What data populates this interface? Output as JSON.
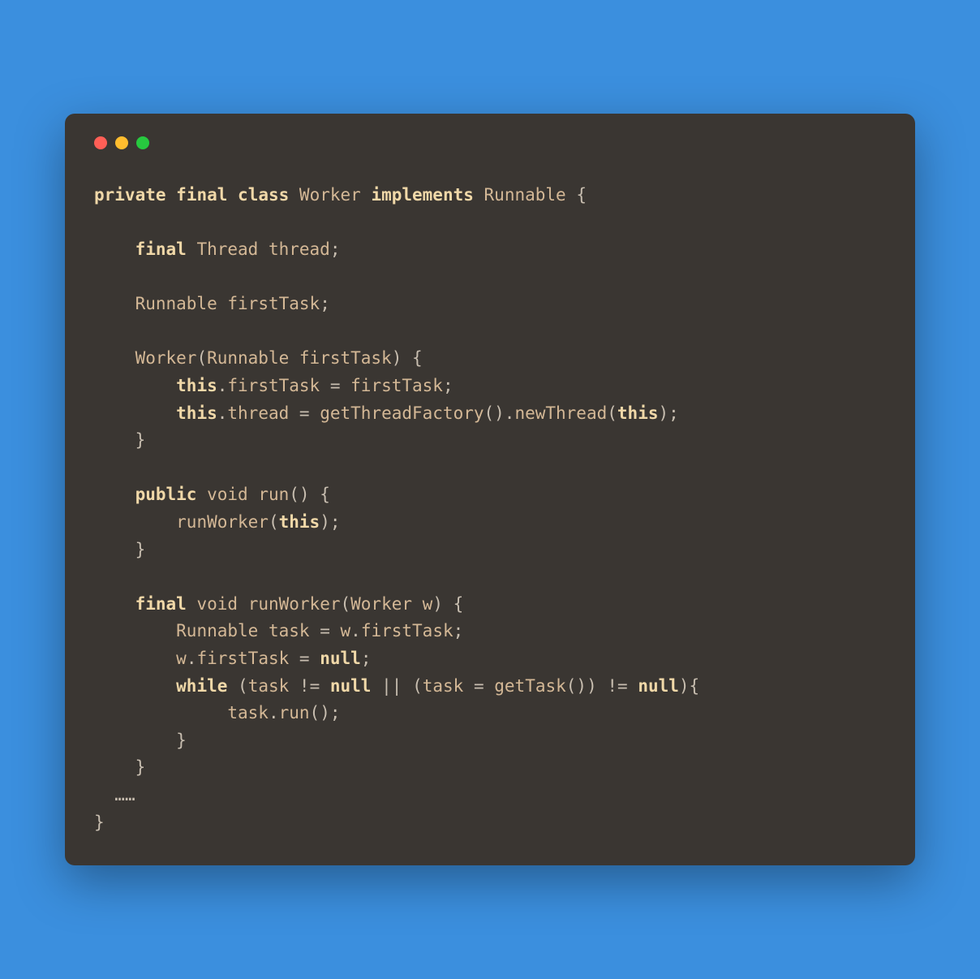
{
  "window": {
    "buttons": [
      "close",
      "minimize",
      "maximize"
    ]
  },
  "code": {
    "tokens": [
      {
        "t": "kw",
        "v": "private"
      },
      {
        "t": "sp",
        "v": " "
      },
      {
        "t": "kw",
        "v": "final"
      },
      {
        "t": "sp",
        "v": " "
      },
      {
        "t": "kw",
        "v": "class"
      },
      {
        "t": "sp",
        "v": " "
      },
      {
        "t": "type",
        "v": "Worker"
      },
      {
        "t": "sp",
        "v": " "
      },
      {
        "t": "kw",
        "v": "implements"
      },
      {
        "t": "sp",
        "v": " "
      },
      {
        "t": "type",
        "v": "Runnable"
      },
      {
        "t": "sp",
        "v": " "
      },
      {
        "t": "punct",
        "v": "{"
      },
      {
        "t": "nl",
        "v": "\n\n"
      },
      {
        "t": "sp",
        "v": "    "
      },
      {
        "t": "kw",
        "v": "final"
      },
      {
        "t": "sp",
        "v": " "
      },
      {
        "t": "type",
        "v": "Thread"
      },
      {
        "t": "sp",
        "v": " "
      },
      {
        "t": "ident",
        "v": "thread"
      },
      {
        "t": "punct",
        "v": ";"
      },
      {
        "t": "nl",
        "v": "\n\n"
      },
      {
        "t": "sp",
        "v": "    "
      },
      {
        "t": "type",
        "v": "Runnable"
      },
      {
        "t": "sp",
        "v": " "
      },
      {
        "t": "ident",
        "v": "firstTask"
      },
      {
        "t": "punct",
        "v": ";"
      },
      {
        "t": "nl",
        "v": "\n\n"
      },
      {
        "t": "sp",
        "v": "    "
      },
      {
        "t": "type",
        "v": "Worker"
      },
      {
        "t": "punct",
        "v": "("
      },
      {
        "t": "type",
        "v": "Runnable"
      },
      {
        "t": "sp",
        "v": " "
      },
      {
        "t": "ident",
        "v": "firstTask"
      },
      {
        "t": "punct",
        "v": ")"
      },
      {
        "t": "sp",
        "v": " "
      },
      {
        "t": "punct",
        "v": "{"
      },
      {
        "t": "nl",
        "v": "\n"
      },
      {
        "t": "sp",
        "v": "        "
      },
      {
        "t": "kw",
        "v": "this"
      },
      {
        "t": "punct",
        "v": "."
      },
      {
        "t": "ident",
        "v": "firstTask"
      },
      {
        "t": "sp",
        "v": " "
      },
      {
        "t": "punct",
        "v": "="
      },
      {
        "t": "sp",
        "v": " "
      },
      {
        "t": "ident",
        "v": "firstTask"
      },
      {
        "t": "punct",
        "v": ";"
      },
      {
        "t": "nl",
        "v": "\n"
      },
      {
        "t": "sp",
        "v": "        "
      },
      {
        "t": "kw",
        "v": "this"
      },
      {
        "t": "punct",
        "v": "."
      },
      {
        "t": "ident",
        "v": "thread"
      },
      {
        "t": "sp",
        "v": " "
      },
      {
        "t": "punct",
        "v": "="
      },
      {
        "t": "sp",
        "v": " "
      },
      {
        "t": "method",
        "v": "getThreadFactory"
      },
      {
        "t": "punct",
        "v": "()."
      },
      {
        "t": "method",
        "v": "newThread"
      },
      {
        "t": "punct",
        "v": "("
      },
      {
        "t": "kw",
        "v": "this"
      },
      {
        "t": "punct",
        "v": ");"
      },
      {
        "t": "nl",
        "v": "\n"
      },
      {
        "t": "sp",
        "v": "    "
      },
      {
        "t": "punct",
        "v": "}"
      },
      {
        "t": "nl",
        "v": "\n\n"
      },
      {
        "t": "sp",
        "v": "    "
      },
      {
        "t": "kw",
        "v": "public"
      },
      {
        "t": "sp",
        "v": " "
      },
      {
        "t": "type",
        "v": "void"
      },
      {
        "t": "sp",
        "v": " "
      },
      {
        "t": "method",
        "v": "run"
      },
      {
        "t": "punct",
        "v": "()"
      },
      {
        "t": "sp",
        "v": " "
      },
      {
        "t": "punct",
        "v": "{"
      },
      {
        "t": "nl",
        "v": "\n"
      },
      {
        "t": "sp",
        "v": "        "
      },
      {
        "t": "method",
        "v": "runWorker"
      },
      {
        "t": "punct",
        "v": "("
      },
      {
        "t": "kw",
        "v": "this"
      },
      {
        "t": "punct",
        "v": ");"
      },
      {
        "t": "nl",
        "v": "\n"
      },
      {
        "t": "sp",
        "v": "    "
      },
      {
        "t": "punct",
        "v": "}"
      },
      {
        "t": "nl",
        "v": "\n\n"
      },
      {
        "t": "sp",
        "v": "    "
      },
      {
        "t": "kw",
        "v": "final"
      },
      {
        "t": "sp",
        "v": " "
      },
      {
        "t": "type",
        "v": "void"
      },
      {
        "t": "sp",
        "v": " "
      },
      {
        "t": "method",
        "v": "runWorker"
      },
      {
        "t": "punct",
        "v": "("
      },
      {
        "t": "type",
        "v": "Worker"
      },
      {
        "t": "sp",
        "v": " "
      },
      {
        "t": "ident",
        "v": "w"
      },
      {
        "t": "punct",
        "v": ")"
      },
      {
        "t": "sp",
        "v": " "
      },
      {
        "t": "punct",
        "v": "{"
      },
      {
        "t": "nl",
        "v": "\n"
      },
      {
        "t": "sp",
        "v": "        "
      },
      {
        "t": "type",
        "v": "Runnable"
      },
      {
        "t": "sp",
        "v": " "
      },
      {
        "t": "ident",
        "v": "task"
      },
      {
        "t": "sp",
        "v": " "
      },
      {
        "t": "punct",
        "v": "="
      },
      {
        "t": "sp",
        "v": " "
      },
      {
        "t": "ident",
        "v": "w"
      },
      {
        "t": "punct",
        "v": "."
      },
      {
        "t": "ident",
        "v": "firstTask"
      },
      {
        "t": "punct",
        "v": ";"
      },
      {
        "t": "nl",
        "v": "\n"
      },
      {
        "t": "sp",
        "v": "        "
      },
      {
        "t": "ident",
        "v": "w"
      },
      {
        "t": "punct",
        "v": "."
      },
      {
        "t": "ident",
        "v": "firstTask"
      },
      {
        "t": "sp",
        "v": " "
      },
      {
        "t": "punct",
        "v": "="
      },
      {
        "t": "sp",
        "v": " "
      },
      {
        "t": "kw",
        "v": "null"
      },
      {
        "t": "punct",
        "v": ";"
      },
      {
        "t": "nl",
        "v": "\n"
      },
      {
        "t": "sp",
        "v": "        "
      },
      {
        "t": "kw",
        "v": "while"
      },
      {
        "t": "sp",
        "v": " "
      },
      {
        "t": "punct",
        "v": "("
      },
      {
        "t": "ident",
        "v": "task"
      },
      {
        "t": "sp",
        "v": " "
      },
      {
        "t": "punct",
        "v": "!="
      },
      {
        "t": "sp",
        "v": " "
      },
      {
        "t": "kw",
        "v": "null"
      },
      {
        "t": "sp",
        "v": " "
      },
      {
        "t": "punct",
        "v": "||"
      },
      {
        "t": "sp",
        "v": " "
      },
      {
        "t": "punct",
        "v": "("
      },
      {
        "t": "ident",
        "v": "task"
      },
      {
        "t": "sp",
        "v": " "
      },
      {
        "t": "punct",
        "v": "="
      },
      {
        "t": "sp",
        "v": " "
      },
      {
        "t": "method",
        "v": "getTask"
      },
      {
        "t": "punct",
        "v": "())"
      },
      {
        "t": "sp",
        "v": " "
      },
      {
        "t": "punct",
        "v": "!="
      },
      {
        "t": "sp",
        "v": " "
      },
      {
        "t": "kw",
        "v": "null"
      },
      {
        "t": "punct",
        "v": "){"
      },
      {
        "t": "nl",
        "v": "\n"
      },
      {
        "t": "sp",
        "v": "             "
      },
      {
        "t": "ident",
        "v": "task"
      },
      {
        "t": "punct",
        "v": "."
      },
      {
        "t": "method",
        "v": "run"
      },
      {
        "t": "punct",
        "v": "();"
      },
      {
        "t": "nl",
        "v": "\n"
      },
      {
        "t": "sp",
        "v": "        "
      },
      {
        "t": "punct",
        "v": "}"
      },
      {
        "t": "nl",
        "v": "\n"
      },
      {
        "t": "sp",
        "v": "    "
      },
      {
        "t": "punct",
        "v": "}"
      },
      {
        "t": "nl",
        "v": "\n"
      },
      {
        "t": "sp",
        "v": "  "
      },
      {
        "t": "punct",
        "v": "……"
      },
      {
        "t": "nl",
        "v": "\n"
      },
      {
        "t": "punct",
        "v": "}"
      }
    ]
  }
}
